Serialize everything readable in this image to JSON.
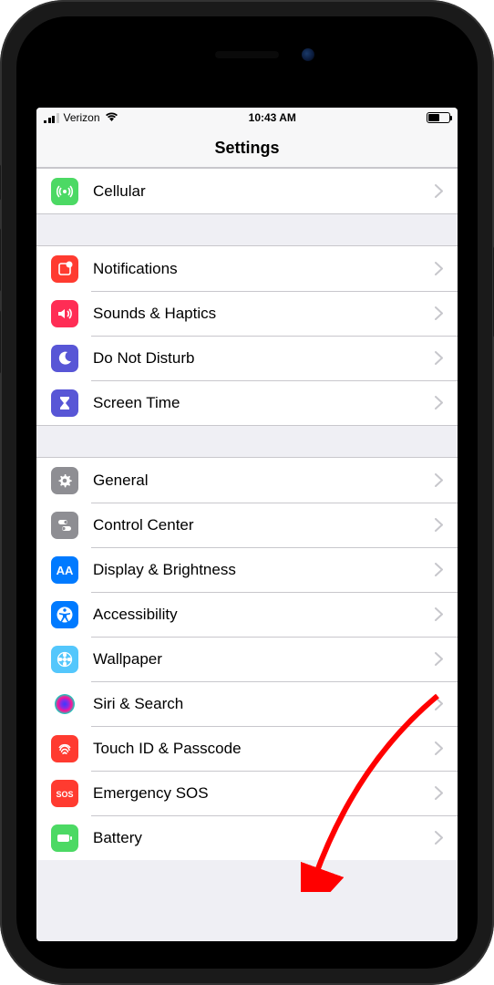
{
  "status": {
    "carrier": "Verizon",
    "time": "10:43 AM"
  },
  "header": {
    "title": "Settings"
  },
  "groups": [
    {
      "items": [
        {
          "key": "cellular",
          "label": "Cellular",
          "icon": "cellular-icon",
          "bg": "#4cd964"
        }
      ]
    },
    {
      "items": [
        {
          "key": "notifications",
          "label": "Notifications",
          "icon": "notifications-icon",
          "bg": "#ff3b30"
        },
        {
          "key": "sounds",
          "label": "Sounds & Haptics",
          "icon": "sounds-icon",
          "bg": "#ff2d55"
        },
        {
          "key": "dnd",
          "label": "Do Not Disturb",
          "icon": "moon-icon",
          "bg": "#5856d6"
        },
        {
          "key": "screentime",
          "label": "Screen Time",
          "icon": "hourglass-icon",
          "bg": "#5856d6"
        }
      ]
    },
    {
      "items": [
        {
          "key": "general",
          "label": "General",
          "icon": "gear-icon",
          "bg": "#8e8e93"
        },
        {
          "key": "controlcenter",
          "label": "Control Center",
          "icon": "switches-icon",
          "bg": "#8e8e93"
        },
        {
          "key": "display",
          "label": "Display & Brightness",
          "icon": "display-icon",
          "bg": "#007aff"
        },
        {
          "key": "accessibility",
          "label": "Accessibility",
          "icon": "accessibility-icon",
          "bg": "#007aff"
        },
        {
          "key": "wallpaper",
          "label": "Wallpaper",
          "icon": "wallpaper-icon",
          "bg": "#54c7fc"
        },
        {
          "key": "siri",
          "label": "Siri & Search",
          "icon": "siri-icon",
          "bg": "#000000"
        },
        {
          "key": "touchid",
          "label": "Touch ID & Passcode",
          "icon": "fingerprint-icon",
          "bg": "#ff3b30"
        },
        {
          "key": "sos",
          "label": "Emergency SOS",
          "icon": "sos-icon",
          "bg": "#ff3b30"
        },
        {
          "key": "battery",
          "label": "Battery",
          "icon": "battery-icon",
          "bg": "#4cd964"
        }
      ]
    }
  ],
  "annotation": {
    "target": "touchid"
  }
}
